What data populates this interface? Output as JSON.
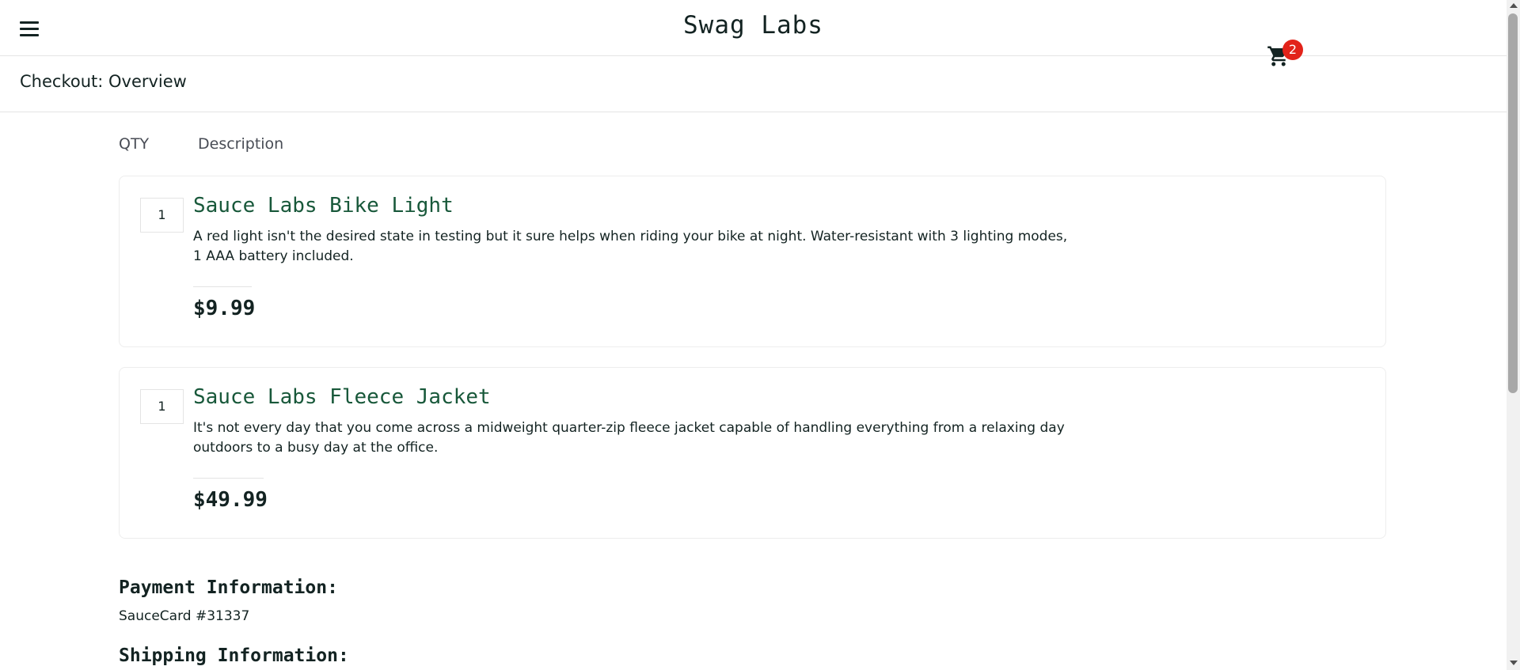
{
  "header": {
    "logo": "Swag Labs",
    "menu_icon": "hamburger-menu-icon",
    "cart_icon": "shopping-cart-icon",
    "cart_count": "2",
    "badge_color": "#e2231a"
  },
  "page": {
    "title": "Checkout: Overview"
  },
  "cart": {
    "qty_label": "QTY",
    "desc_label": "Description",
    "items": [
      {
        "quantity": "1",
        "name": "Sauce Labs Bike Light",
        "description": "A red light isn't the desired state in testing but it sure helps when riding your bike at night. Water-resistant with 3 lighting modes, 1 AAA battery included.",
        "price": "$9.99"
      },
      {
        "quantity": "1",
        "name": "Sauce Labs Fleece Jacket",
        "description": "It's not every day that you come across a midweight quarter-zip fleece jacket capable of handling everything from a relaxing day outdoors to a busy day at the office.",
        "price": "$49.99"
      }
    ]
  },
  "summary": {
    "payment_label": "Payment Information:",
    "payment_value": "SauceCard #31337",
    "shipping_label": "Shipping Information:"
  },
  "colors": {
    "item_name": "#18583a",
    "text": "#132322"
  }
}
